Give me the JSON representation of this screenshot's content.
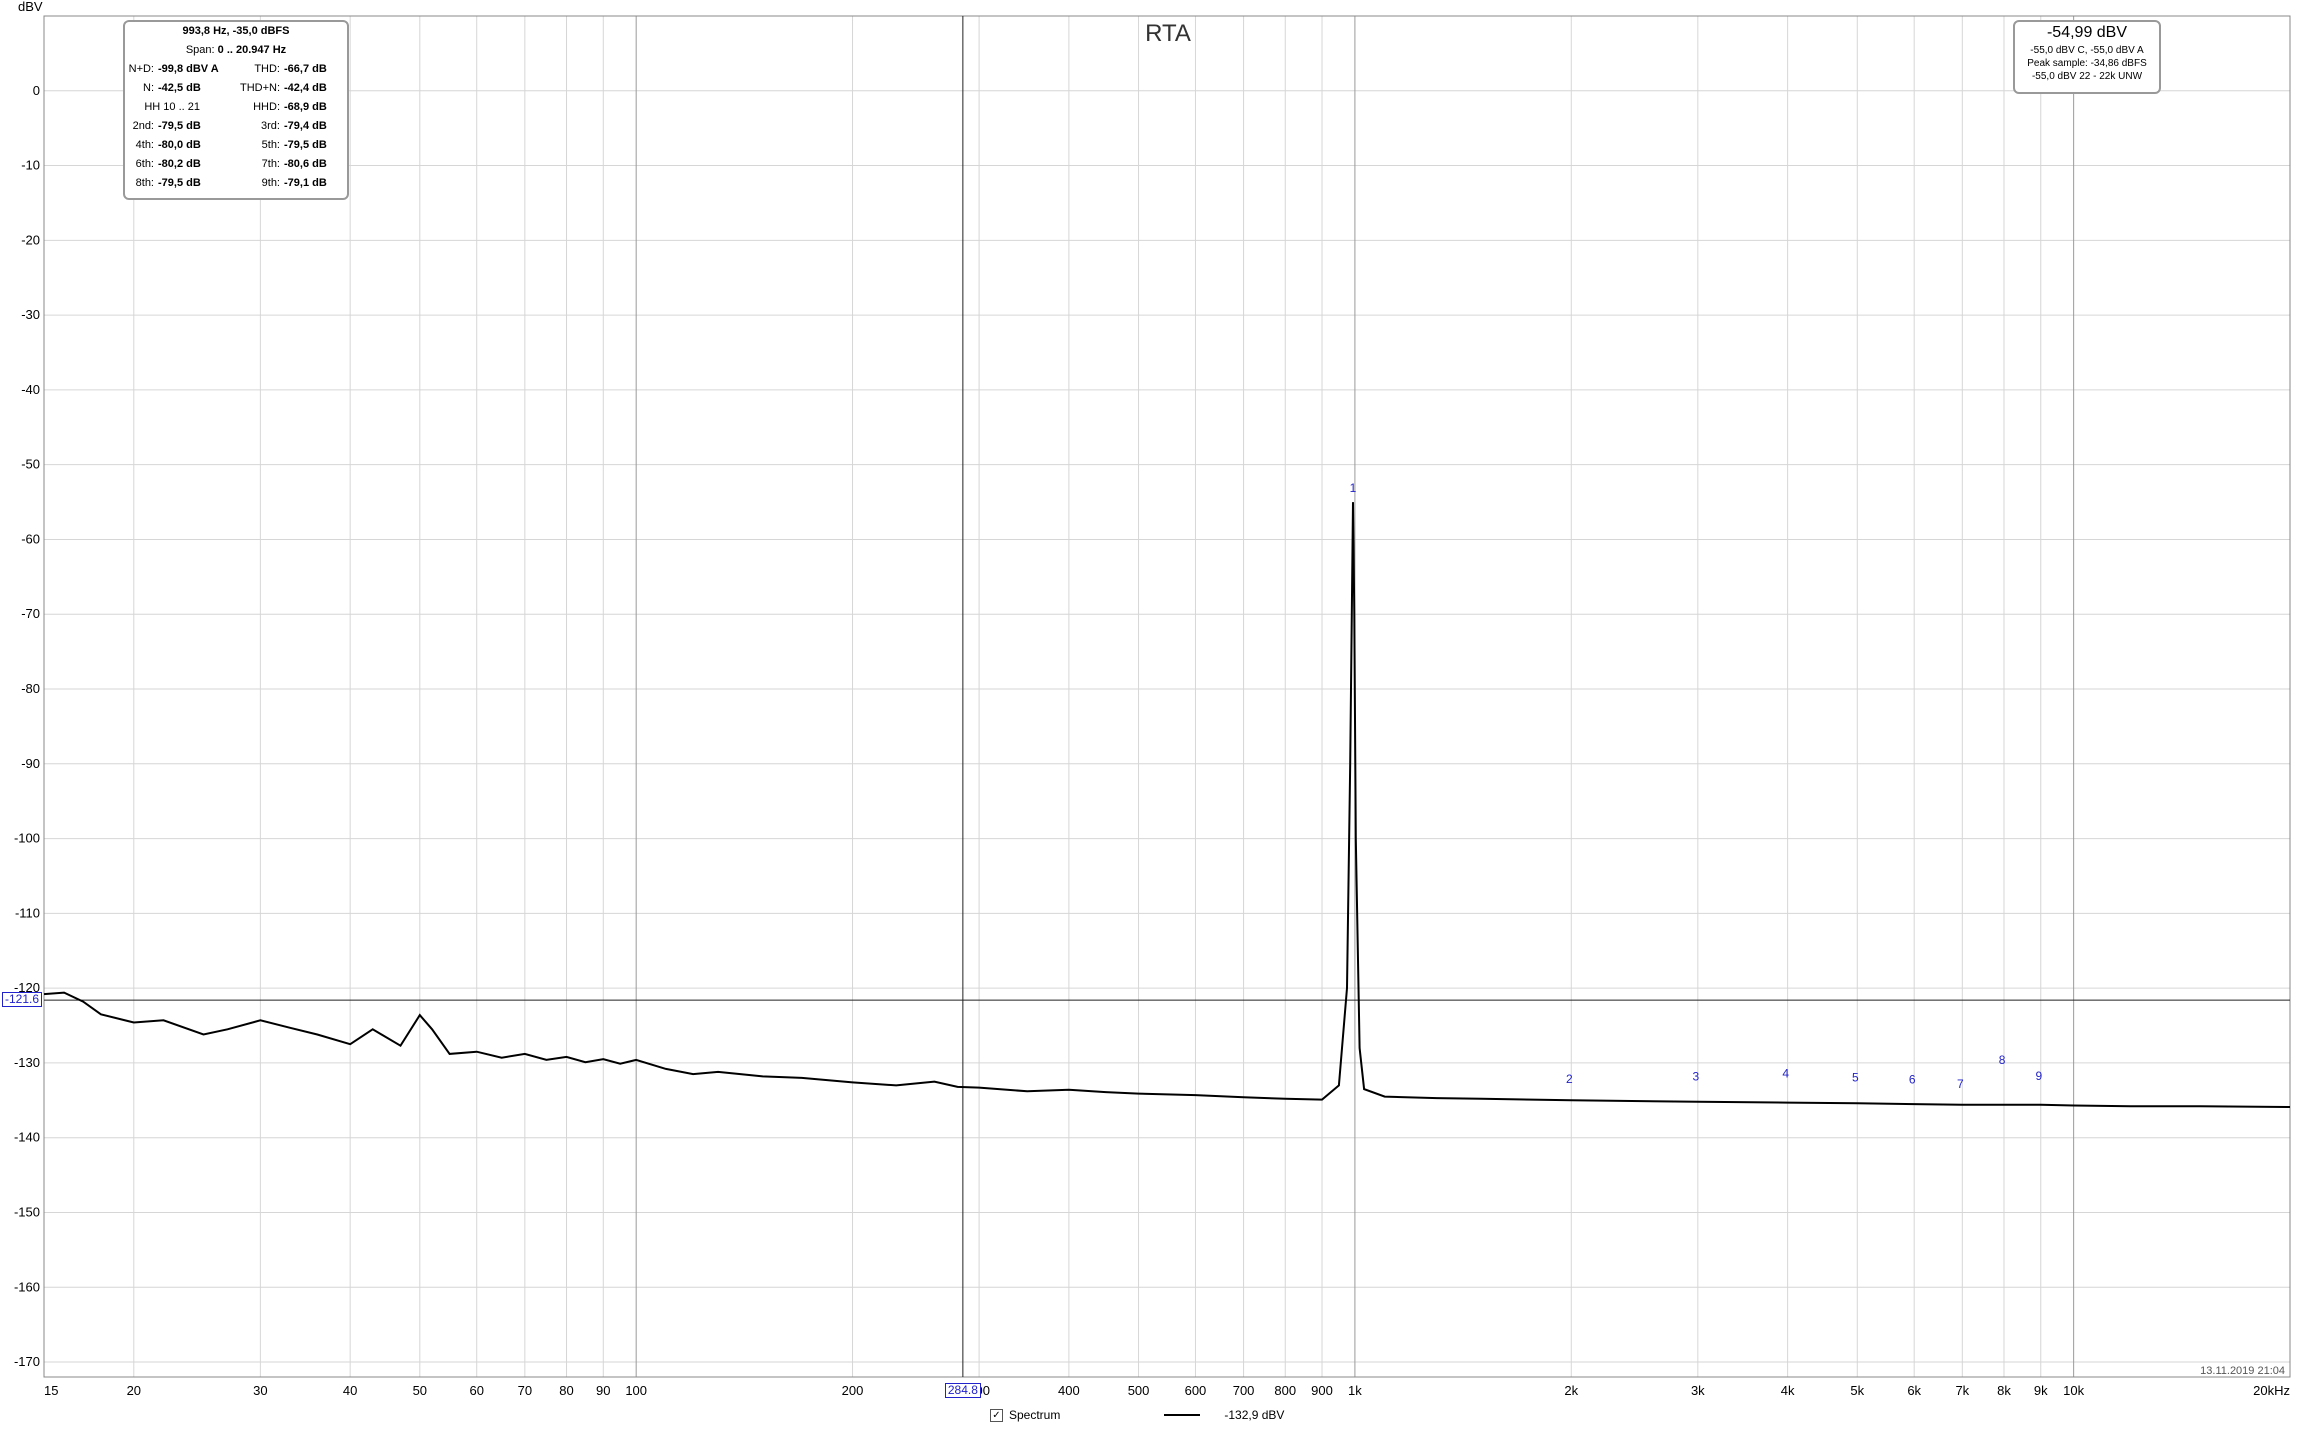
{
  "chart_data": {
    "type": "line",
    "title": "RTA",
    "ylabel": "dBV",
    "xscale": "log",
    "xlim": [
      15,
      20000
    ],
    "ylim": [
      -172,
      10
    ],
    "grid": true,
    "y_ticks": [
      {
        "v": 0,
        "label": "0"
      },
      {
        "v": -10,
        "label": "-10"
      },
      {
        "v": -20,
        "label": "-20"
      },
      {
        "v": -30,
        "label": "-30"
      },
      {
        "v": -40,
        "label": "-40"
      },
      {
        "v": -50,
        "label": "-50"
      },
      {
        "v": -60,
        "label": "-60"
      },
      {
        "v": -70,
        "label": "-70"
      },
      {
        "v": -80,
        "label": "-80"
      },
      {
        "v": -90,
        "label": "-90"
      },
      {
        "v": -100,
        "label": "-100"
      },
      {
        "v": -110,
        "label": "-110"
      },
      {
        "v": -120,
        "label": "-120"
      },
      {
        "v": -130,
        "label": "-130"
      },
      {
        "v": -140,
        "label": "-140"
      },
      {
        "v": -150,
        "label": "-150"
      },
      {
        "v": -160,
        "label": "-160"
      },
      {
        "v": -170,
        "label": "-170"
      }
    ],
    "x_ticks": [
      {
        "v": 15,
        "label": "15"
      },
      {
        "v": 20,
        "label": "20"
      },
      {
        "v": 30,
        "label": "30"
      },
      {
        "v": 40,
        "label": "40"
      },
      {
        "v": 50,
        "label": "50"
      },
      {
        "v": 60,
        "label": "60"
      },
      {
        "v": 70,
        "label": "70"
      },
      {
        "v": 80,
        "label": "80"
      },
      {
        "v": 90,
        "label": "90"
      },
      {
        "v": 100,
        "label": "100"
      },
      {
        "v": 200,
        "label": "200"
      },
      {
        "v": 300,
        "label": "300"
      },
      {
        "v": 400,
        "label": "400"
      },
      {
        "v": 500,
        "label": "500"
      },
      {
        "v": 600,
        "label": "600"
      },
      {
        "v": 700,
        "label": "700"
      },
      {
        "v": 800,
        "label": "800"
      },
      {
        "v": 900,
        "label": "900"
      },
      {
        "v": 1000,
        "label": "1k"
      },
      {
        "v": 2000,
        "label": "2k"
      },
      {
        "v": 3000,
        "label": "3k"
      },
      {
        "v": 4000,
        "label": "4k"
      },
      {
        "v": 5000,
        "label": "5k"
      },
      {
        "v": 6000,
        "label": "6k"
      },
      {
        "v": 7000,
        "label": "7k"
      },
      {
        "v": 8000,
        "label": "8k"
      },
      {
        "v": 9000,
        "label": "9k"
      },
      {
        "v": 10000,
        "label": "10k"
      },
      {
        "v": 20000,
        "label": "20kHz"
      }
    ],
    "series": [
      {
        "name": "Spectrum",
        "x": [
          15,
          16,
          17,
          18,
          20,
          22,
          25,
          27,
          30,
          33,
          36,
          40,
          43,
          47,
          50,
          52,
          55,
          60,
          65,
          70,
          75,
          80,
          85,
          90,
          95,
          100,
          110,
          120,
          130,
          150,
          170,
          200,
          230,
          260,
          280,
          300,
          350,
          400,
          450,
          500,
          600,
          700,
          800,
          900,
          950,
          975,
          985,
          990,
          993.8,
          998,
          1003,
          1015,
          1030,
          1100,
          1300,
          1500,
          2000,
          3000,
          4000,
          5000,
          6000,
          7000,
          8000,
          9000,
          10000,
          12000,
          15000,
          20000
        ],
        "values": [
          -120.8,
          -120.6,
          -121.8,
          -123.5,
          -124.6,
          -124.3,
          -126.2,
          -125.5,
          -124.3,
          -125.3,
          -126.2,
          -127.5,
          -125.5,
          -127.7,
          -123.6,
          -125.5,
          -128.8,
          -128.5,
          -129.3,
          -128.8,
          -129.6,
          -129.2,
          -129.9,
          -129.5,
          -130.1,
          -129.6,
          -130.8,
          -131.5,
          -131.2,
          -131.8,
          -132.0,
          -132.6,
          -133.0,
          -132.5,
          -133.2,
          -133.3,
          -133.8,
          -133.6,
          -133.9,
          -134.1,
          -134.3,
          -134.6,
          -134.8,
          -134.9,
          -133.0,
          -120.0,
          -90.0,
          -70.0,
          -55.0,
          -70.0,
          -100.0,
          -128.0,
          -133.5,
          -134.5,
          -134.7,
          -134.8,
          -135.0,
          -135.2,
          -135.3,
          -135.4,
          -135.5,
          -135.6,
          -135.6,
          -135.6,
          -135.7,
          -135.8,
          -135.8,
          -135.9
        ]
      }
    ],
    "harmonic_markers": [
      {
        "label": "1",
        "x": 993.8,
        "y": -55.0
      },
      {
        "label": "2",
        "x": 1987.6,
        "y": -134.0
      },
      {
        "label": "3",
        "x": 2981.4,
        "y": -133.7
      },
      {
        "label": "4",
        "x": 3975.2,
        "y": -133.3
      },
      {
        "label": "5",
        "x": 4969,
        "y": -133.8
      },
      {
        "label": "6",
        "x": 5962.8,
        "y": -134.1
      },
      {
        "label": "7",
        "x": 6956.6,
        "y": -134.7
      },
      {
        "label": "8",
        "x": 7950.4,
        "y": -131.5
      },
      {
        "label": "9",
        "x": 8944.2,
        "y": -133.6
      }
    ],
    "cursor": {
      "x": 284.8,
      "x_label": "284.8",
      "y": -121.6,
      "y_label": "-121.6"
    }
  },
  "harmonics_box": {
    "header": "993,8 Hz, -35,0 dBFS",
    "span_label": "Span:",
    "span_value": "0 .. 20.947 Hz",
    "rows": [
      {
        "l1": "N+D:",
        "v1": "-99,8 dBV A",
        "l2": "THD:",
        "v2": "-66,7 dB"
      },
      {
        "l1": "N:",
        "v1": "-42,5 dB",
        "l2": "THD+N:",
        "v2": "-42,4 dB"
      },
      {
        "l1": "HH 10 .. 21",
        "v1": "",
        "l2": "HHD:",
        "v2": "-68,9 dB"
      },
      {
        "l1": "2nd:",
        "v1": "-79,5 dB",
        "l2": "3rd:",
        "v2": "-79,4 dB"
      },
      {
        "l1": "4th:",
        "v1": "-80,0 dB",
        "l2": "5th:",
        "v2": "-79,5 dB"
      },
      {
        "l1": "6th:",
        "v1": "-80,2 dB",
        "l2": "7th:",
        "v2": "-80,6 dB"
      },
      {
        "l1": "8th:",
        "v1": "-79,5 dB",
        "l2": "9th:",
        "v2": "-79,1 dB"
      }
    ]
  },
  "level_box": {
    "main": "-54,99 dBV",
    "line1": "-55,0 dBV C, -55,0 dBV A",
    "line2": "Peak sample: -34,86 dBFS",
    "line3": "-55,0 dBV 22 - 22k UNW"
  },
  "legend": {
    "checkbox_mark": "✓",
    "series_label": "Spectrum",
    "value_label": "-132,9 dBV"
  },
  "timestamp": "13.11.2019 21:04"
}
